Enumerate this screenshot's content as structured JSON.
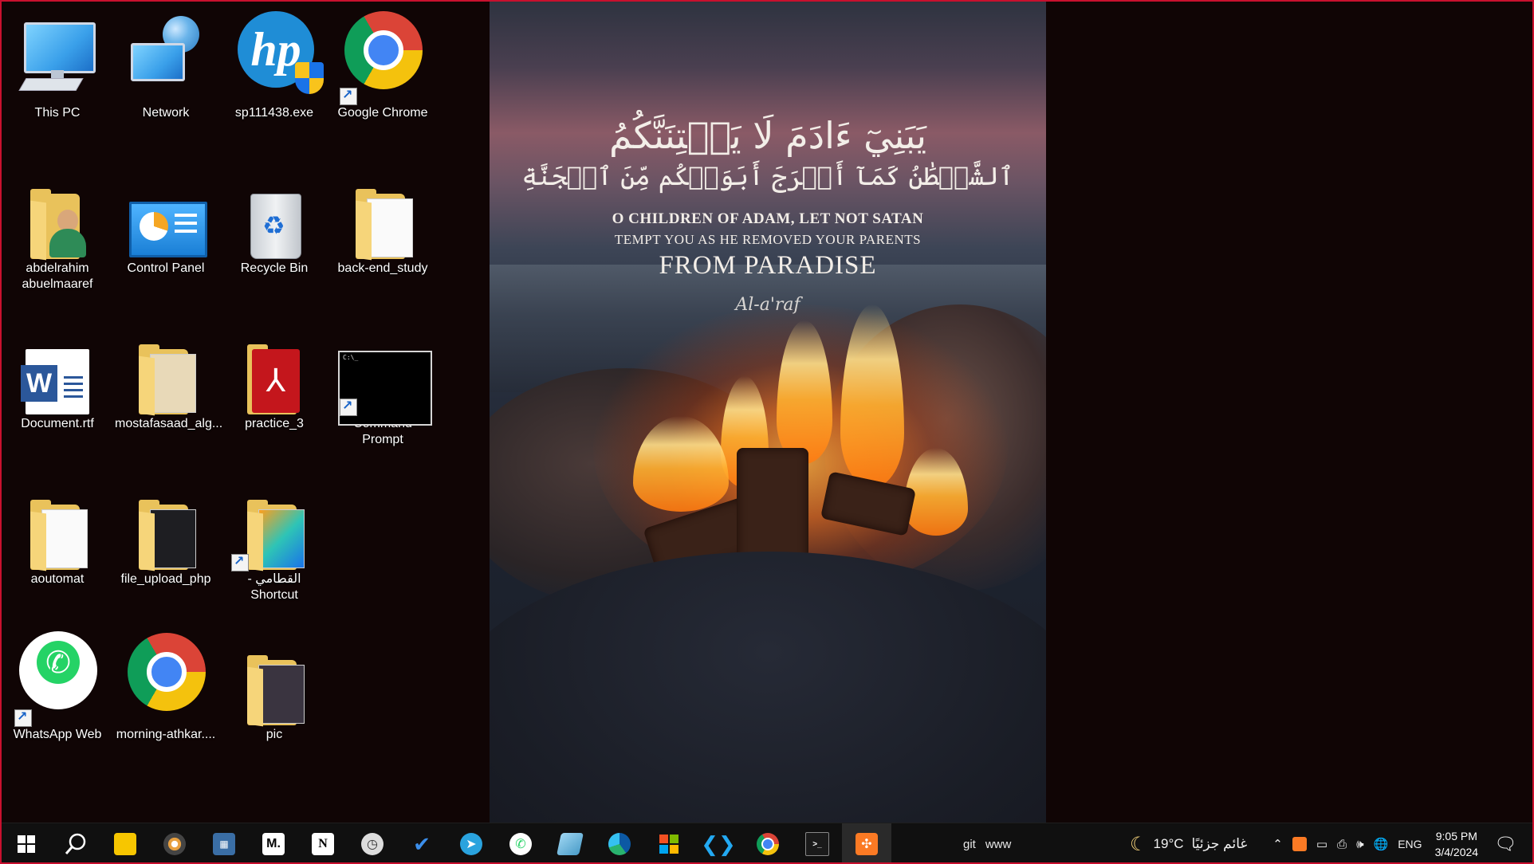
{
  "desktop": {
    "icons": [
      {
        "label": "This PC",
        "icon": "this-pc-icon"
      },
      {
        "label": "Network",
        "icon": "network-icon"
      },
      {
        "label": "sp111438.exe",
        "icon": "hp-installer-icon"
      },
      {
        "label": "Google Chrome",
        "icon": "chrome-icon"
      },
      {
        "label": "abdelrahim abuelmaaref",
        "icon": "user-folder-icon"
      },
      {
        "label": "Control Panel",
        "icon": "control-panel-icon"
      },
      {
        "label": "Recycle Bin",
        "icon": "recycle-bin-icon"
      },
      {
        "label": "back-end_study",
        "icon": "folder-icon"
      },
      {
        "label": "Document.rtf",
        "icon": "word-document-icon"
      },
      {
        "label": "mostafasaad_alg...",
        "icon": "folder-icon"
      },
      {
        "label": "practice_3",
        "icon": "pdf-folder-icon"
      },
      {
        "label": "Command Prompt",
        "icon": "command-prompt-icon"
      },
      {
        "label": "aoutomat",
        "icon": "folder-icon"
      },
      {
        "label": "file_upload_php",
        "icon": "folder-icon"
      },
      {
        "label": "القطامي - Shortcut",
        "icon": "folder-shortcut-icon"
      },
      {
        "label": "WhatsApp Web",
        "icon": "whatsapp-icon"
      },
      {
        "label": "morning-athkar....",
        "icon": "chrome-icon"
      },
      {
        "label": "pic",
        "icon": "folder-icon"
      }
    ]
  },
  "wallpaper": {
    "arabic_line1": "يَبَنِيٓ ءَادَمَ لَا يَفۡتِنَنَّكُمُ",
    "arabic_line2": "ٱلشَّيۡطَٰنُ كَمَآ أَخۡرَجَ أَبَوَيۡكُم مِّنَ ٱلۡجَنَّةِ",
    "english_line1": "O CHILDREN OF ADAM, LET NOT SATAN",
    "english_line2": "TEMPT YOU AS HE REMOVED YOUR PARENTS",
    "english_line3": "FROM PARADISE",
    "signature": "Al-a'raf"
  },
  "taskbar": {
    "apps": [
      {
        "name": "start-button",
        "icon": "windows-logo-icon"
      },
      {
        "name": "search-button",
        "icon": "search-icon"
      },
      {
        "name": "sticky-notes",
        "icon": "sticky-notes-icon"
      },
      {
        "name": "media-player",
        "icon": "media-player-icon"
      },
      {
        "name": "calculator",
        "icon": "calculator-icon"
      },
      {
        "name": "medium",
        "icon": "medium-icon",
        "text": "M."
      },
      {
        "name": "notion",
        "icon": "notion-icon",
        "text": "N"
      },
      {
        "name": "clock-app",
        "icon": "clock-icon"
      },
      {
        "name": "todo",
        "icon": "todo-check-icon"
      },
      {
        "name": "telegram",
        "icon": "telegram-icon"
      },
      {
        "name": "whatsapp",
        "icon": "whatsapp-icon"
      },
      {
        "name": "notepad",
        "icon": "notepad-icon"
      },
      {
        "name": "edge",
        "icon": "edge-icon"
      },
      {
        "name": "microsoft-store",
        "icon": "store-icon"
      },
      {
        "name": "vscode",
        "icon": "vscode-icon"
      },
      {
        "name": "chrome",
        "icon": "chrome-icon"
      },
      {
        "name": "terminal",
        "icon": "terminal-icon"
      },
      {
        "name": "xampp",
        "icon": "xampp-icon"
      }
    ],
    "toolbar_links": [
      "git",
      "www"
    ],
    "weather": {
      "temp": "19°C",
      "condition": "غائم جزئيًا"
    },
    "language": "ENG",
    "time": "9:05 PM",
    "date": "3/4/2024"
  },
  "colors": {
    "accent": "#8ab4f8",
    "desktop_bg": "#100505",
    "frame_border": "#c8102e"
  }
}
